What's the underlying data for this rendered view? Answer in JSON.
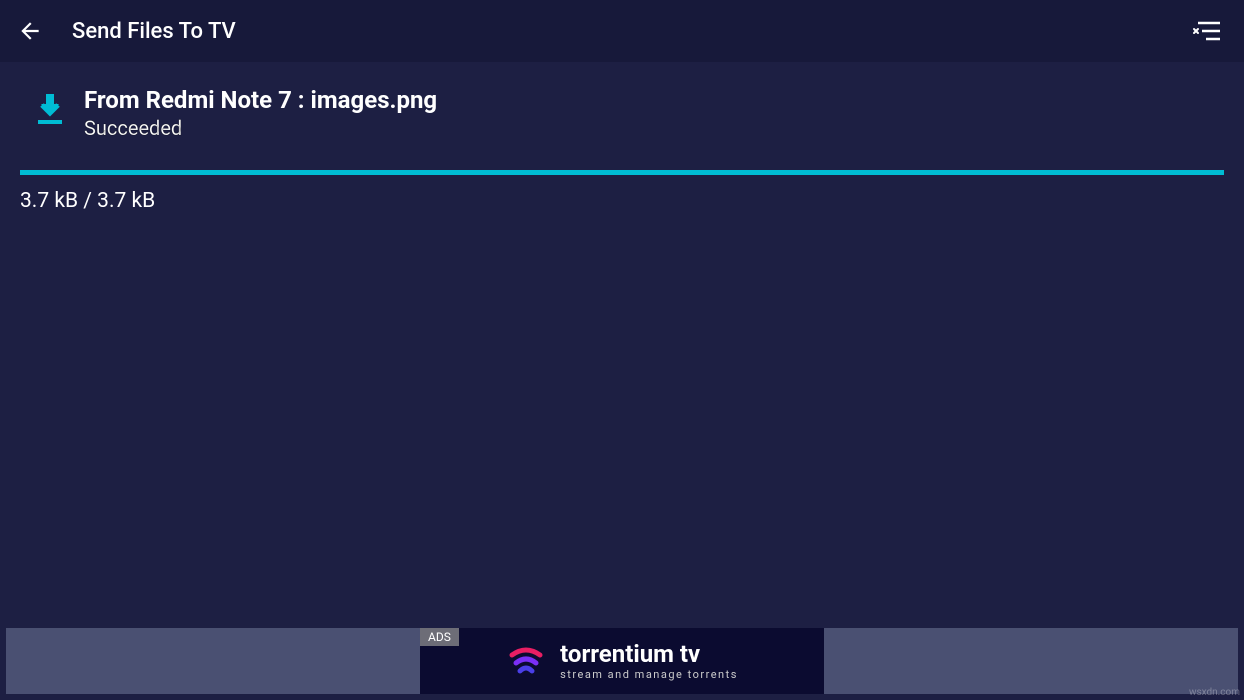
{
  "header": {
    "title": "Send Files To TV"
  },
  "transfer": {
    "title": "From Redmi Note 7 : images.png",
    "status": "Succeeded",
    "size_text": "3.7 kB / 3.7 kB"
  },
  "ad": {
    "label": "ADS",
    "brand": "torrentium tv",
    "tagline": "stream and manage torrents"
  },
  "watermark": "wsxdn.com",
  "colors": {
    "accent": "#00bcd4",
    "header_bg": "#17193a",
    "body_bg": "#1d1f43"
  }
}
